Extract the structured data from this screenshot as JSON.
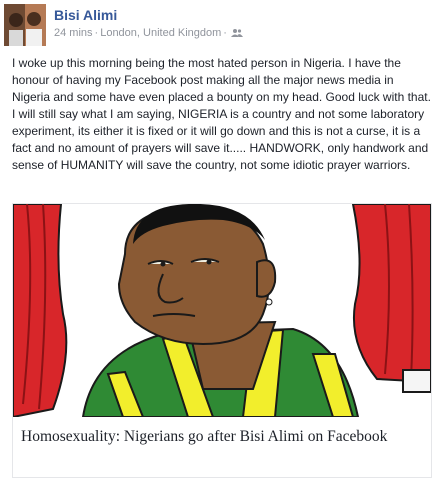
{
  "post": {
    "author": "Bisi Alimi",
    "time": "24 mins",
    "location": "London, United Kingdom",
    "body": "I woke up this morning being the most hated person in Nigeria. I have the honour of having my Facebook post making all the major news media in Nigeria and some have even placed a bounty on my head. Good luck with that. I will still say what I am saying, NIGERIA is a country and not some laboratory experiment, its either it is fixed or it will go down and this is not a curse, it is a fact and no amount of prayers will save it..... HANDWORK, only handwork and sense of HUMANITY will save the country, not some idiotic prayer warriors.",
    "audience_icon": "friends-icon"
  },
  "link": {
    "title": "Homosexuality: Nigerians go after Bisi Alimi on Facebook"
  },
  "colors": {
    "author_link": "#365899",
    "meta_gray": "#90949c",
    "curtain_red": "#d8262a",
    "skin": "#8a5a34",
    "shirt_green": "#2f8a34",
    "shirt_yellow": "#f2ee2c"
  }
}
